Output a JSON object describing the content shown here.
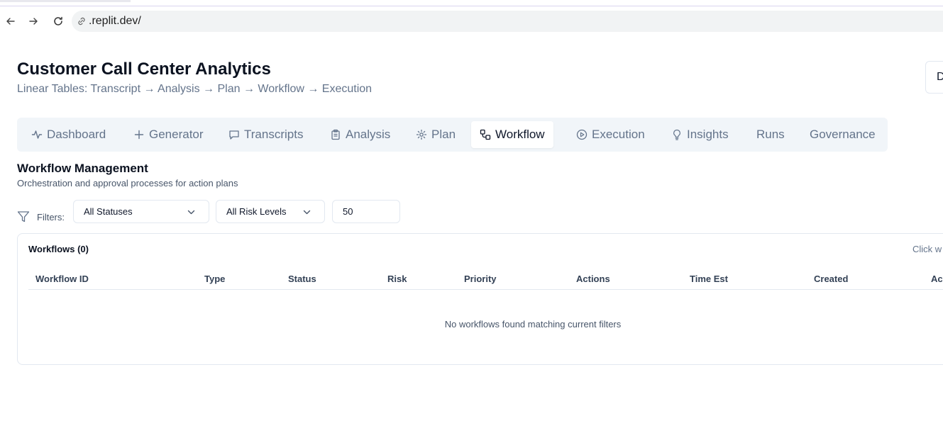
{
  "browser": {
    "url": ".replit.dev/",
    "back_icon": "arrow-left-icon",
    "forward_icon": "arrow-right-icon",
    "reload_icon": "reload-icon"
  },
  "header": {
    "title": "Customer Call Center Analytics",
    "subtitle": "Linear Tables: Transcript → Analysis → Plan → Workflow → Execution",
    "corner_button": "D"
  },
  "tabs": [
    {
      "label": "Dashboard",
      "icon": "activity-icon"
    },
    {
      "label": "Generator",
      "icon": "plus-icon"
    },
    {
      "label": "Transcripts",
      "icon": "message-square-icon"
    },
    {
      "label": "Analysis",
      "icon": "clipboard-icon"
    },
    {
      "label": "Plan",
      "icon": "gear-icon"
    },
    {
      "label": "Workflow",
      "icon": "workflow-icon",
      "active": true
    },
    {
      "label": "Execution",
      "icon": "play-circle-icon"
    },
    {
      "label": "Insights",
      "icon": "lightbulb-icon"
    },
    {
      "label": "Runs",
      "icon": ""
    },
    {
      "label": "Governance",
      "icon": ""
    }
  ],
  "section": {
    "title": "Workflow Management",
    "subtitle": "Orchestration and approval processes for action plans"
  },
  "filters": {
    "label": "Filters:",
    "status": "All Statuses",
    "risk": "All Risk Levels",
    "limit": "50"
  },
  "table": {
    "title": "Workflows (0)",
    "hint": "Click w",
    "columns": [
      "Workflow ID",
      "Type",
      "Status",
      "Risk",
      "Priority",
      "Actions",
      "Time Est",
      "Created",
      "Ac"
    ],
    "empty_message": "No workflows found matching current filters"
  },
  "colors": {
    "tab_bar_bg": "#f1f5f9",
    "muted_text": "#64748b",
    "border": "#e2e8f0"
  }
}
